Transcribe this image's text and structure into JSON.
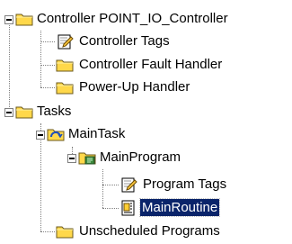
{
  "tree": {
    "controller": "Controller POINT_IO_Controller",
    "controller_tags": "Controller Tags",
    "fault_handler": "Controller Fault Handler",
    "powerup_handler": "Power-Up Handler",
    "tasks": "Tasks",
    "main_task": "MainTask",
    "main_program": "MainProgram",
    "program_tags": "Program Tags",
    "main_routine": "MainRoutine",
    "unscheduled": "Unscheduled Programs"
  },
  "selected_item": "MainRoutine",
  "colors": {
    "folder": "#ffd84a",
    "selection": "#0a246a",
    "tree_lines": "#808080"
  }
}
